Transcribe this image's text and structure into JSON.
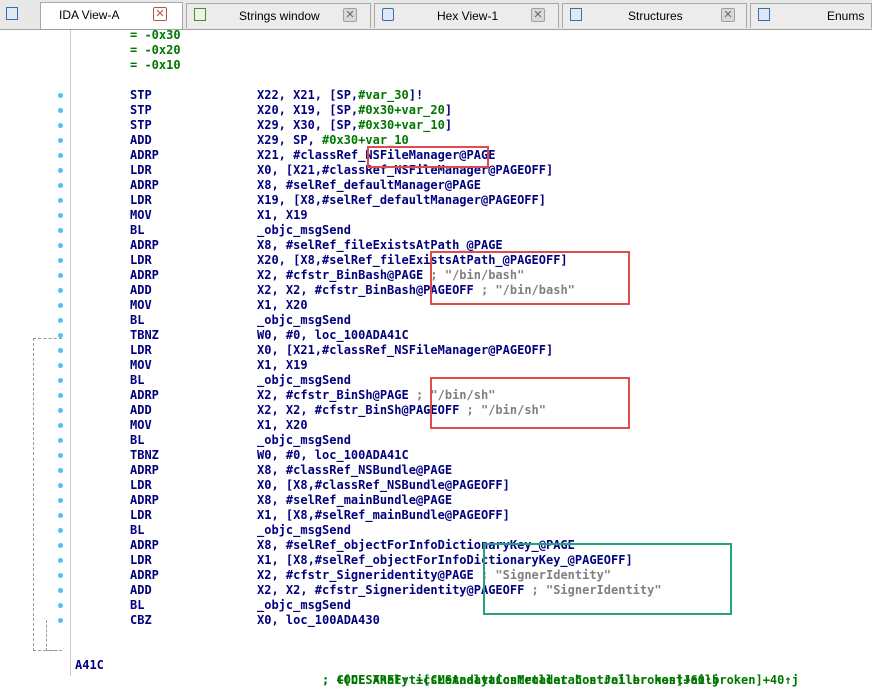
{
  "tabs": [
    {
      "label": "IDA View-A",
      "icon": "ida-view-icon",
      "active": true
    },
    {
      "label": "Strings window",
      "icon": "strings-icon",
      "active": false
    },
    {
      "label": "Hex View-1",
      "icon": "hex-view-icon",
      "active": false
    },
    {
      "label": "Structures",
      "icon": "structures-icon",
      "active": false
    },
    {
      "label": "Enums",
      "icon": "enums-icon",
      "active": false
    }
  ],
  "stack_vars": [
    "= -0x30",
    "= -0x20",
    "= -0x10"
  ],
  "instructions": [
    {
      "mn": "STP",
      "pre": "X22, X21, [SP,",
      "sym": "#var_30",
      "post": "]!"
    },
    {
      "mn": "STP",
      "pre": "X20, X19, [SP,",
      "sym": "#0x30+var_20",
      "post": "]"
    },
    {
      "mn": "STP",
      "pre": "X29, X30, [SP,",
      "sym": "#0x30+var_10",
      "post": "]"
    },
    {
      "mn": "ADD",
      "pre": "X29, SP, ",
      "sym": "#0x30+var_10",
      "post": ""
    },
    {
      "mn": "ADRP",
      "pre": "X21, #classRef_NSFileManager@PAGE",
      "sym": "",
      "post": ""
    },
    {
      "mn": "LDR",
      "pre": "X0, [X21,#classRef_NSFileManager@PAGEOFF]",
      "sym": "",
      "post": ""
    },
    {
      "mn": "ADRP",
      "pre": "X8, #selRef_defaultManager@PAGE",
      "sym": "",
      "post": ""
    },
    {
      "mn": "LDR",
      "pre": "X19, [X8,#selRef_defaultManager@PAGEOFF]",
      "sym": "",
      "post": ""
    },
    {
      "mn": "MOV",
      "pre": "X1, X19",
      "sym": "",
      "post": ""
    },
    {
      "mn": "BL",
      "pre": "_objc_msgSend",
      "sym": "",
      "post": ""
    },
    {
      "mn": "ADRP",
      "pre": "X8, #selRef_fileExistsAtPath_@PAGE",
      "sym": "",
      "post": ""
    },
    {
      "mn": "LDR",
      "pre": "X20, [X8,#selRef_fileExistsAtPath_@PAGEOFF]",
      "sym": "",
      "post": ""
    },
    {
      "mn": "ADRP",
      "pre": "X2, #cfstr_BinBash@PAGE",
      "sym": "",
      "post": "",
      "cmt": " ; \"/bin/bash\""
    },
    {
      "mn": "ADD",
      "pre": "X2, X2, #cfstr_BinBash@PAGEOFF",
      "sym": "",
      "post": "",
      "cmt": " ; \"/bin/bash\""
    },
    {
      "mn": "MOV",
      "pre": "X1, X20",
      "sym": "",
      "post": ""
    },
    {
      "mn": "BL",
      "pre": "_objc_msgSend",
      "sym": "",
      "post": ""
    },
    {
      "mn": "TBNZ",
      "pre": "W0, #0, loc_100ADA41C",
      "sym": "",
      "post": ""
    },
    {
      "mn": "LDR",
      "pre": "X0, [X21,#classRef_NSFileManager@PAGEOFF]",
      "sym": "",
      "post": ""
    },
    {
      "mn": "MOV",
      "pre": "X1, X19",
      "sym": "",
      "post": ""
    },
    {
      "mn": "BL",
      "pre": "_objc_msgSend",
      "sym": "",
      "post": ""
    },
    {
      "mn": "ADRP",
      "pre": "X2, #cfstr_BinSh@PAGE",
      "sym": "",
      "post": "",
      "cmt": " ; \"/bin/sh\""
    },
    {
      "mn": "ADD",
      "pre": "X2, X2, #cfstr_BinSh@PAGEOFF",
      "sym": "",
      "post": "",
      "cmt": " ; \"/bin/sh\""
    },
    {
      "mn": "MOV",
      "pre": "X1, X20",
      "sym": "",
      "post": ""
    },
    {
      "mn": "BL",
      "pre": "_objc_msgSend",
      "sym": "",
      "post": ""
    },
    {
      "mn": "TBNZ",
      "pre": "W0, #0, loc_100ADA41C",
      "sym": "",
      "post": ""
    },
    {
      "mn": "ADRP",
      "pre": "X8, #classRef_NSBundle@PAGE",
      "sym": "",
      "post": ""
    },
    {
      "mn": "LDR",
      "pre": "X0, [X8,#classRef_NSBundle@PAGEOFF]",
      "sym": "",
      "post": ""
    },
    {
      "mn": "ADRP",
      "pre": "X8, #selRef_mainBundle@PAGE",
      "sym": "",
      "post": ""
    },
    {
      "mn": "LDR",
      "pre": "X1, [X8,#selRef_mainBundle@PAGEOFF]",
      "sym": "",
      "post": ""
    },
    {
      "mn": "BL",
      "pre": "_objc_msgSend",
      "sym": "",
      "post": ""
    },
    {
      "mn": "ADRP",
      "pre": "X8, #selRef_objectForInfoDictionaryKey_@PAGE",
      "sym": "",
      "post": ""
    },
    {
      "mn": "LDR",
      "pre": "X1, [X8,#selRef_objectForInfoDictionaryKey_@PAGEOFF]",
      "sym": "",
      "post": ""
    },
    {
      "mn": "ADRP",
      "pre": "X2, #cfstr_Signeridentity@PAGE",
      "sym": "",
      "post": "",
      "cmt": " ; \"SignerIdentity\""
    },
    {
      "mn": "ADD",
      "pre": "X2, X2, #cfstr_Signeridentity@PAGEOFF",
      "sym": "",
      "post": "",
      "cmt": " ; \"SignerIdentity\""
    },
    {
      "mn": "BL",
      "pre": "_objc_msgSend",
      "sym": "",
      "post": ""
    },
    {
      "mn": "CBZ",
      "pre": "X0, loc_100ADA430",
      "sym": "",
      "post": ""
    }
  ],
  "label_line": {
    "label": "A41C",
    "xref1": "; CODE XREF: +[CLSAnalyticsMetadataController hostJailbroken]+40↑j",
    "xref2": "; +[CLSAnalyticsMetadataController hostJailbroken]+60↑j"
  },
  "highlight_colors": {
    "red": "#e04b4b",
    "green": "#2aa083"
  }
}
